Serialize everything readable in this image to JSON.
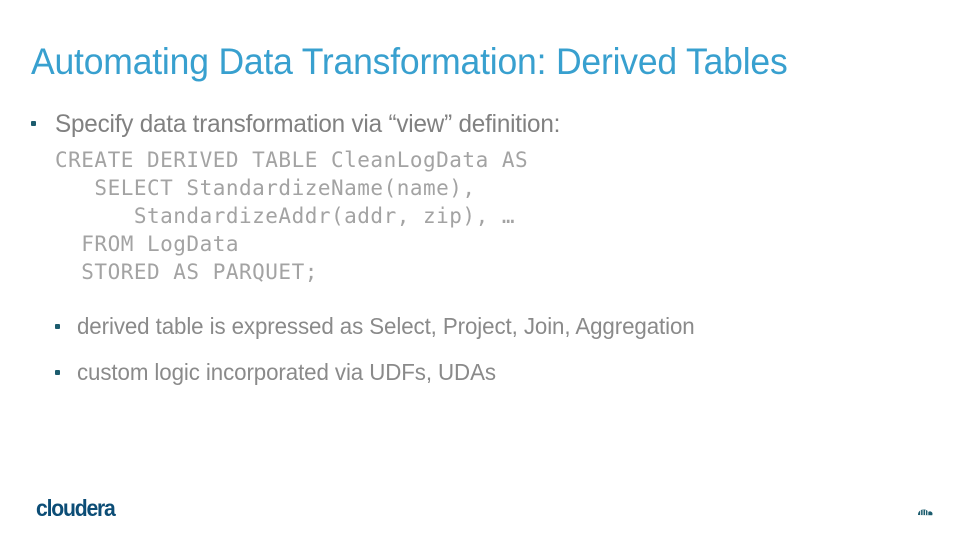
{
  "slide": {
    "title": "Automating Data Transformation: Derived Tables",
    "title_color": "#38a0cf",
    "background_color": "#ffffff",
    "body_text_color": "#818181",
    "code_text_color": "#a3a3a3",
    "bullet_marker_color": "#1c5c6e"
  },
  "body": {
    "bullet_1": {
      "marker": "square-bullet-icon",
      "text": "Specify data transformation via “view” definition:"
    },
    "code": {
      "lines": [
        "CREATE DERIVED TABLE CleanLogData AS",
        "   SELECT StandardizeName(name),",
        "      StandardizeAddr(addr, zip), …",
        "  FROM LogData",
        "  STORED AS PARQUET;"
      ]
    },
    "sub_bullets": [
      {
        "marker": "square-bullet-icon",
        "text": "derived table is expressed as Select, Project, Join, Aggregation"
      },
      {
        "marker": "square-bullet-icon",
        "text": "custom logic incorporated via UDFs, UDAs"
      }
    ]
  },
  "footer": {
    "logo_text": "cloudera",
    "logo_color": "#0c4d76",
    "corner_mark": "cloudera-small-mark-icon",
    "corner_mark_color": "#1c5c6e"
  }
}
